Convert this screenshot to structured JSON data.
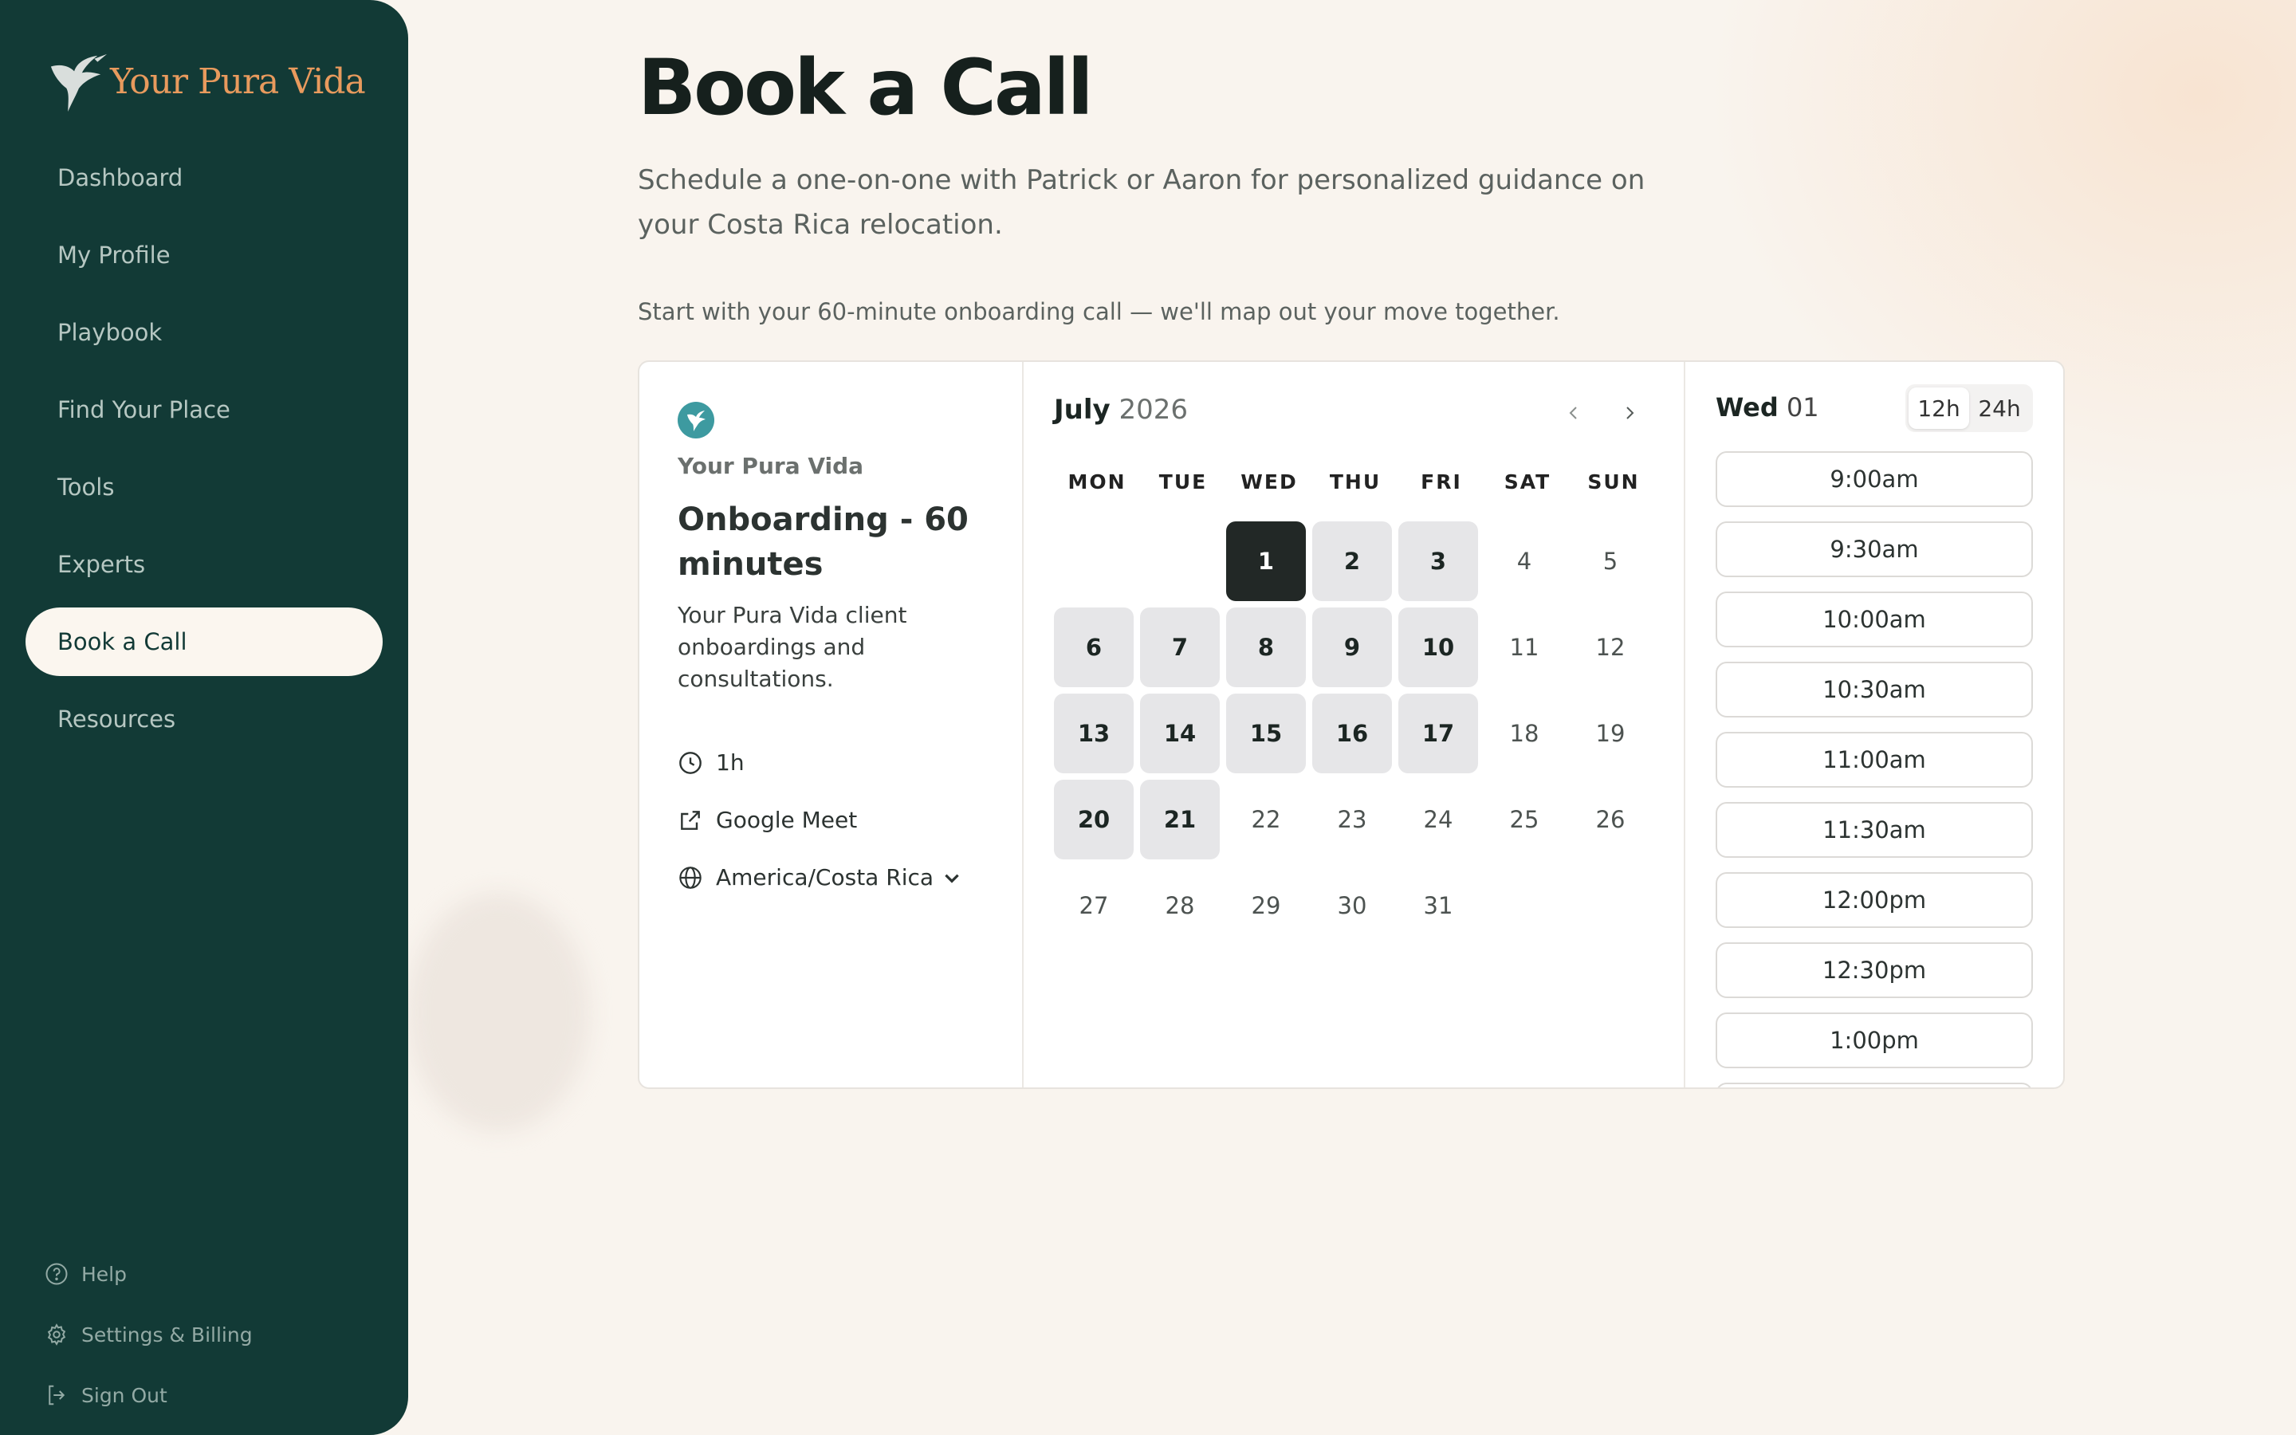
{
  "app": {
    "name": "Your Pura Vida"
  },
  "sidebar": {
    "items": [
      {
        "label": "Dashboard"
      },
      {
        "label": "My Profile"
      },
      {
        "label": "Playbook"
      },
      {
        "label": "Find Your Place"
      },
      {
        "label": "Tools"
      },
      {
        "label": "Experts"
      },
      {
        "label": "Book a Call",
        "active": true
      },
      {
        "label": "Resources"
      }
    ],
    "footer": [
      {
        "label": "Help",
        "icon": "help-icon"
      },
      {
        "label": "Settings & Billing",
        "icon": "gear-icon"
      },
      {
        "label": "Sign Out",
        "icon": "sign-out-icon"
      }
    ]
  },
  "page": {
    "title": "Book a Call",
    "subtitle": "Schedule a one-on-one with Patrick or Aaron for personalized guidance on your Costa Rica relocation.",
    "intro": "Start with your 60-minute onboarding call — we'll map out your move together."
  },
  "event": {
    "org": "Your Pura Vida",
    "title": "Onboarding - 60 minutes",
    "description": "Your Pura Vida client onboardings and consultations.",
    "duration": "1h",
    "location": "Google Meet",
    "timezone": "America/Costa Rica"
  },
  "calendar": {
    "month": "July",
    "year": "2026",
    "weekdays": [
      "MON",
      "TUE",
      "WED",
      "THU",
      "FRI",
      "SAT",
      "SUN"
    ],
    "days": [
      {
        "n": "",
        "s": "empty"
      },
      {
        "n": "",
        "s": "empty"
      },
      {
        "n": "1",
        "s": "sel"
      },
      {
        "n": "2",
        "s": "avail"
      },
      {
        "n": "3",
        "s": "avail"
      },
      {
        "n": "4",
        "s": ""
      },
      {
        "n": "5",
        "s": ""
      },
      {
        "n": "6",
        "s": "avail"
      },
      {
        "n": "7",
        "s": "avail"
      },
      {
        "n": "8",
        "s": "avail"
      },
      {
        "n": "9",
        "s": "avail"
      },
      {
        "n": "10",
        "s": "avail"
      },
      {
        "n": "11",
        "s": ""
      },
      {
        "n": "12",
        "s": ""
      },
      {
        "n": "13",
        "s": "avail"
      },
      {
        "n": "14",
        "s": "avail"
      },
      {
        "n": "15",
        "s": "avail"
      },
      {
        "n": "16",
        "s": "avail"
      },
      {
        "n": "17",
        "s": "avail"
      },
      {
        "n": "18",
        "s": ""
      },
      {
        "n": "19",
        "s": ""
      },
      {
        "n": "20",
        "s": "avail"
      },
      {
        "n": "21",
        "s": "avail"
      },
      {
        "n": "22",
        "s": ""
      },
      {
        "n": "23",
        "s": ""
      },
      {
        "n": "24",
        "s": ""
      },
      {
        "n": "25",
        "s": ""
      },
      {
        "n": "26",
        "s": ""
      },
      {
        "n": "27",
        "s": ""
      },
      {
        "n": "28",
        "s": ""
      },
      {
        "n": "29",
        "s": ""
      },
      {
        "n": "30",
        "s": ""
      },
      {
        "n": "31",
        "s": ""
      }
    ]
  },
  "slots": {
    "day_name": "Wed",
    "day_num": "01",
    "format_12": "12h",
    "format_24": "24h",
    "times": [
      "9:00am",
      "9:30am",
      "10:00am",
      "10:30am",
      "11:00am",
      "11:30am",
      "12:00pm",
      "12:30pm",
      "1:00pm",
      ""
    ]
  },
  "colors": {
    "sidebar": "#123a36",
    "accent": "#e89a5d",
    "selected_day": "#222826",
    "available_day": "#e6e6e8"
  }
}
